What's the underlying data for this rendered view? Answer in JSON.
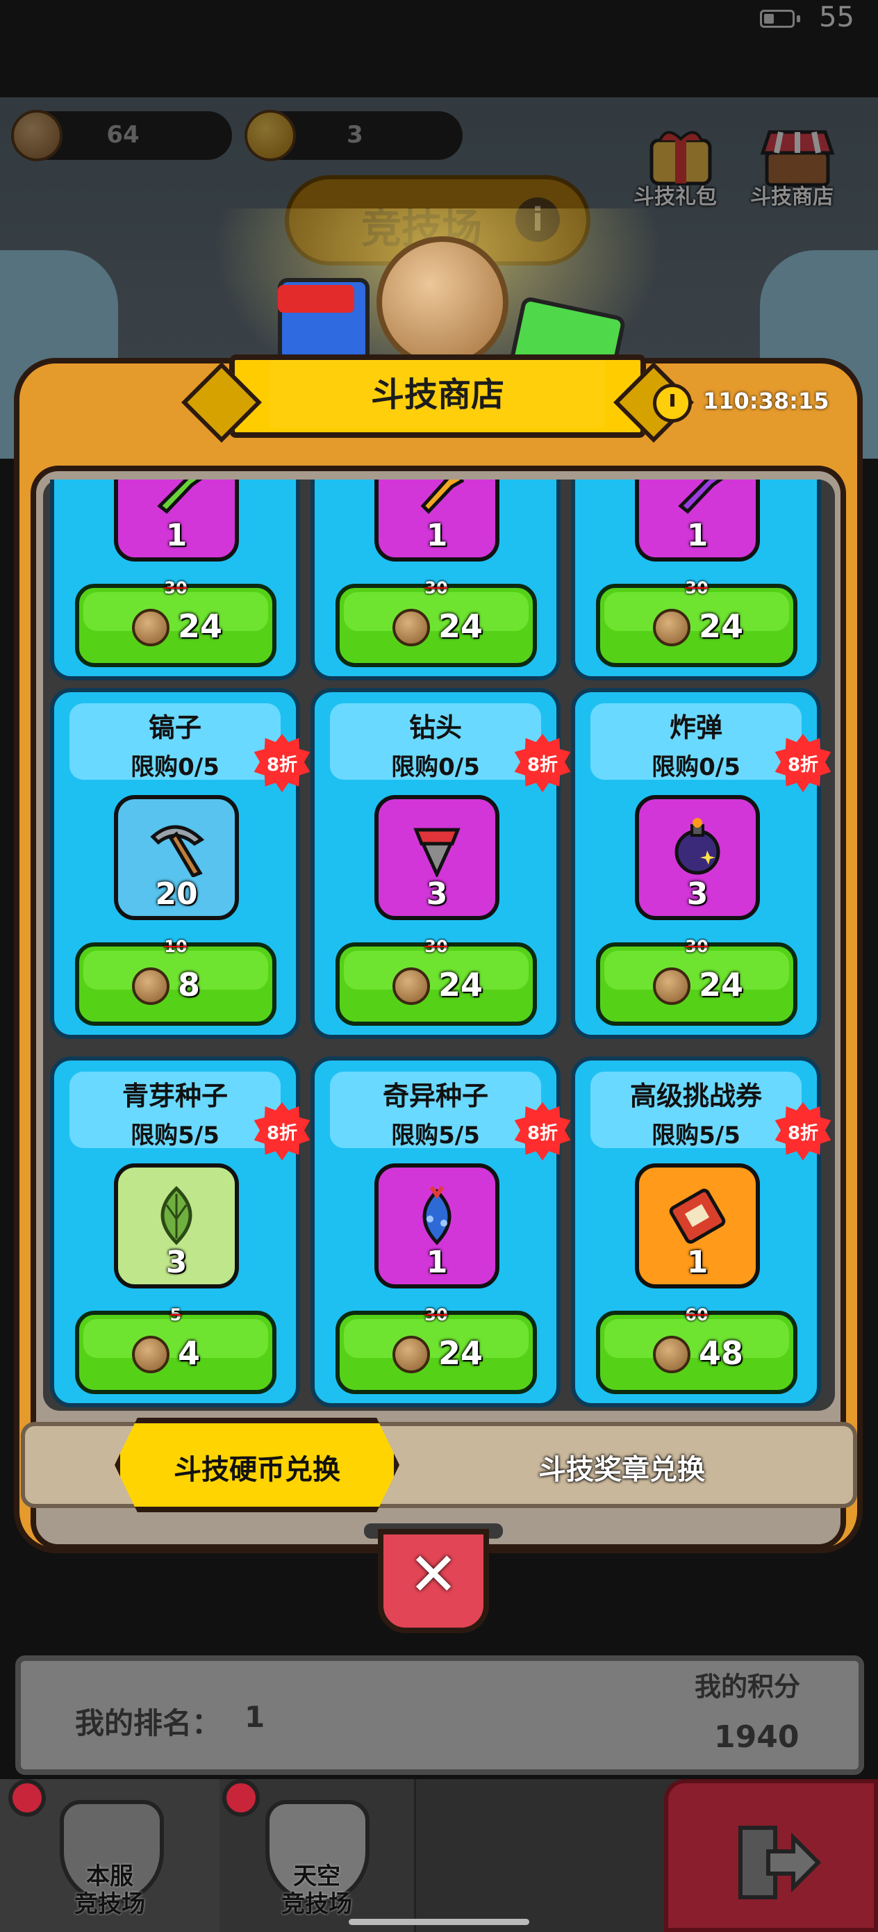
{
  "status": {
    "battery": "55"
  },
  "currency": {
    "coins": "64",
    "medals": "3"
  },
  "top_buttons": {
    "gift": "斗技礼包",
    "shop": "斗技商店"
  },
  "arena_title": "竞技场",
  "shop": {
    "title": "斗技商店",
    "timer": "110:38:15"
  },
  "partial_row": [
    {
      "qty": "1",
      "old_price": "30",
      "price": "24",
      "color": "#d236d8"
    },
    {
      "qty": "1",
      "old_price": "30",
      "price": "24",
      "color": "#d236d8"
    },
    {
      "qty": "1",
      "old_price": "30",
      "price": "24",
      "color": "#d236d8"
    }
  ],
  "items": [
    {
      "name": "镐子",
      "limit": "限购0/5",
      "discount": "8折",
      "qty": "20",
      "old_price": "10",
      "price": "8",
      "box_color": "#57c3ee",
      "icon": "pickaxe-icon"
    },
    {
      "name": "钻头",
      "limit": "限购0/5",
      "discount": "8折",
      "qty": "3",
      "old_price": "30",
      "price": "24",
      "box_color": "#d236d8",
      "icon": "drill-icon"
    },
    {
      "name": "炸弹",
      "limit": "限购0/5",
      "discount": "8折",
      "qty": "3",
      "old_price": "30",
      "price": "24",
      "box_color": "#d236d8",
      "icon": "bomb-icon"
    },
    {
      "name": "青芽种子",
      "limit": "限购5/5",
      "discount": "8折",
      "qty": "3",
      "old_price": "5",
      "price": "4",
      "box_color": "#bfe68a",
      "icon": "green-seed-icon"
    },
    {
      "name": "奇异种子",
      "limit": "限购5/5",
      "discount": "8折",
      "qty": "1",
      "old_price": "30",
      "price": "24",
      "box_color": "#d236d8",
      "icon": "strange-seed-icon"
    },
    {
      "name": "高级挑战券",
      "limit": "限购5/5",
      "discount": "8折",
      "qty": "1",
      "old_price": "60",
      "price": "48",
      "box_color": "#ff9a1a",
      "icon": "challenge-ticket-icon"
    }
  ],
  "tabs": {
    "coin_exchange": "斗技硬币兑换",
    "medal_exchange": "斗技奖章兑换"
  },
  "close": "✕",
  "rank": {
    "label": "我的排名：",
    "value": "1",
    "score_label": "我的积分",
    "score_value": "1940"
  },
  "nav": {
    "local_line1": "本服",
    "local_line2": "竞技场",
    "sky_line1": "天空",
    "sky_line2": "竞技场"
  }
}
